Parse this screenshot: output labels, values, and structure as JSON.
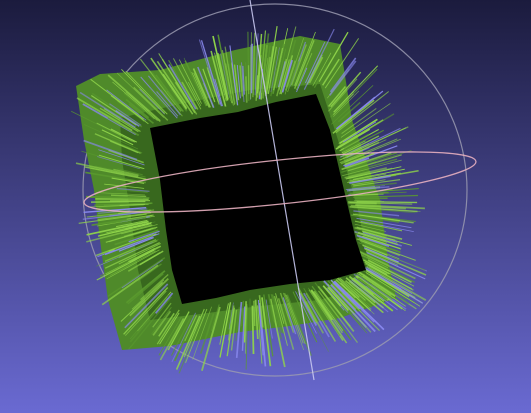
{
  "viewer": {
    "background_top": "#1b1b3d",
    "background_bottom": "#6a6ad2",
    "mesh_color": "#5a9a2e",
    "mesh_highlight": "#8fd44a",
    "mesh_shadow": "#2f5a1a",
    "hole_color": "#000000",
    "normal_line_color": "#8888ee",
    "trackball_color": "#9a9ab0",
    "trackball_axis_red": "#e8b0c0",
    "trackball_axis_blue": "#c8c8f0"
  }
}
